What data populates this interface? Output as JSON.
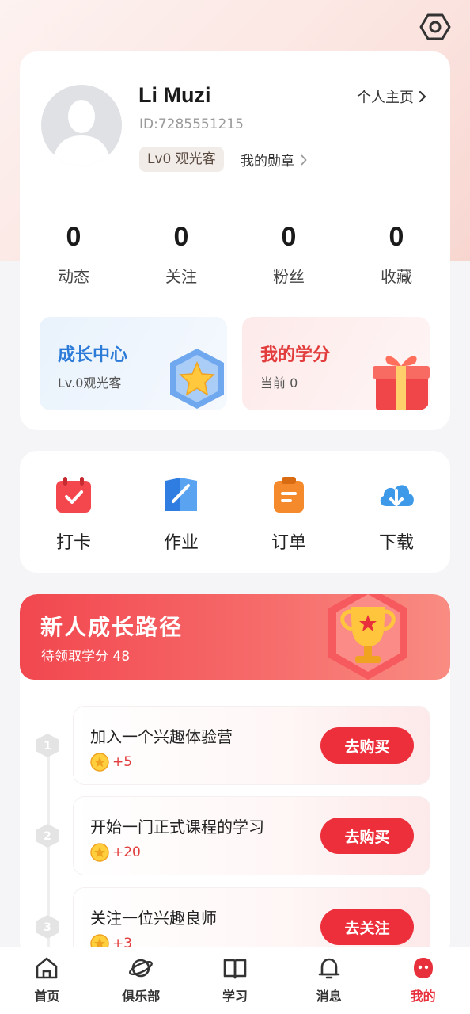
{
  "profile": {
    "username": "Li Muzi",
    "user_id": "ID:7285551215",
    "homepage_label": "个人主页",
    "level_badge": "Lv0 观光客",
    "medal_label": "我的勋章"
  },
  "stats": [
    {
      "value": "0",
      "label": "动态"
    },
    {
      "value": "0",
      "label": "关注"
    },
    {
      "value": "0",
      "label": "粉丝"
    },
    {
      "value": "0",
      "label": "收藏"
    }
  ],
  "growth_center": {
    "title": "成长中心",
    "subtitle": "Lv.0观光客"
  },
  "my_credits": {
    "title": "我的学分",
    "subtitle": "当前 0"
  },
  "tools": [
    {
      "label": "打卡",
      "icon": "calendar-check-icon"
    },
    {
      "label": "作业",
      "icon": "notebook-icon"
    },
    {
      "label": "订单",
      "icon": "clipboard-icon"
    },
    {
      "label": "下载",
      "icon": "cloud-download-icon"
    }
  ],
  "growth_path": {
    "title": "新人成长路径",
    "subtitle": "待领取学分 48",
    "tasks": [
      {
        "num": "1",
        "name": "加入一个兴趣体验营",
        "reward": "+5",
        "button": "去购买"
      },
      {
        "num": "2",
        "name": "开始一门正式课程的学习",
        "reward": "+20",
        "button": "去购买"
      },
      {
        "num": "3",
        "name": "关注一位兴趣良师",
        "reward": "+3",
        "button": "去关注"
      }
    ]
  },
  "tabbar": [
    {
      "label": "首页",
      "icon": "home-icon"
    },
    {
      "label": "俱乐部",
      "icon": "planet-icon"
    },
    {
      "label": "学习",
      "icon": "book-icon"
    },
    {
      "label": "消息",
      "icon": "bell-icon"
    },
    {
      "label": "我的",
      "icon": "profile-face-icon"
    }
  ],
  "colors": {
    "accent_red": "#e8303c",
    "growth_blue": "#2d7bd8",
    "banner_gradient_start": "#f2474f"
  }
}
